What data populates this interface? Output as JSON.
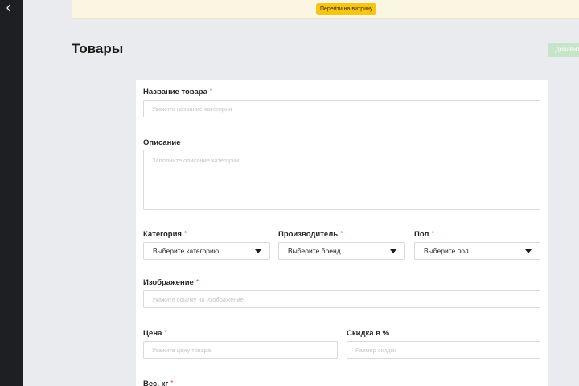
{
  "header": {
    "store_button": "Перейти на витрину"
  },
  "page": {
    "title": "Товары",
    "add_button": "Добавить"
  },
  "form": {
    "name": {
      "label": "Название товара",
      "required": "*",
      "placeholder": "Укажите название категории",
      "value": ""
    },
    "description": {
      "label": "Описание",
      "placeholder": "Заполните описание категории",
      "value": ""
    },
    "category": {
      "label": "Категория",
      "required": "*",
      "selected": "Выберите категорию"
    },
    "brand": {
      "label": "Производитель",
      "required": "*",
      "selected": "Выберите бренд"
    },
    "gender": {
      "label": "Пол",
      "required": "*",
      "selected": "Выберите пол"
    },
    "image": {
      "label": "Изображение",
      "required": "*",
      "placeholder": "Укажите ссылку на изображение",
      "value": ""
    },
    "price": {
      "label": "Цена",
      "required": "*",
      "placeholder": "Укажите цену товара",
      "value": ""
    },
    "discount": {
      "label": "Скидка в %",
      "placeholder": "Размер скидки",
      "value": ""
    },
    "weight": {
      "label": "Вес, кг",
      "required": "*"
    }
  },
  "icons": {
    "back": "chevron-left-icon",
    "dropdown": "caret-down-icon"
  },
  "colors": {
    "sidebar": "#1e1f23",
    "banner": "#fbf6e2",
    "store_button": "#f6c515",
    "add_button": "#c6e4c7",
    "required_mark": "#e53935",
    "background": "#e9ebef"
  }
}
